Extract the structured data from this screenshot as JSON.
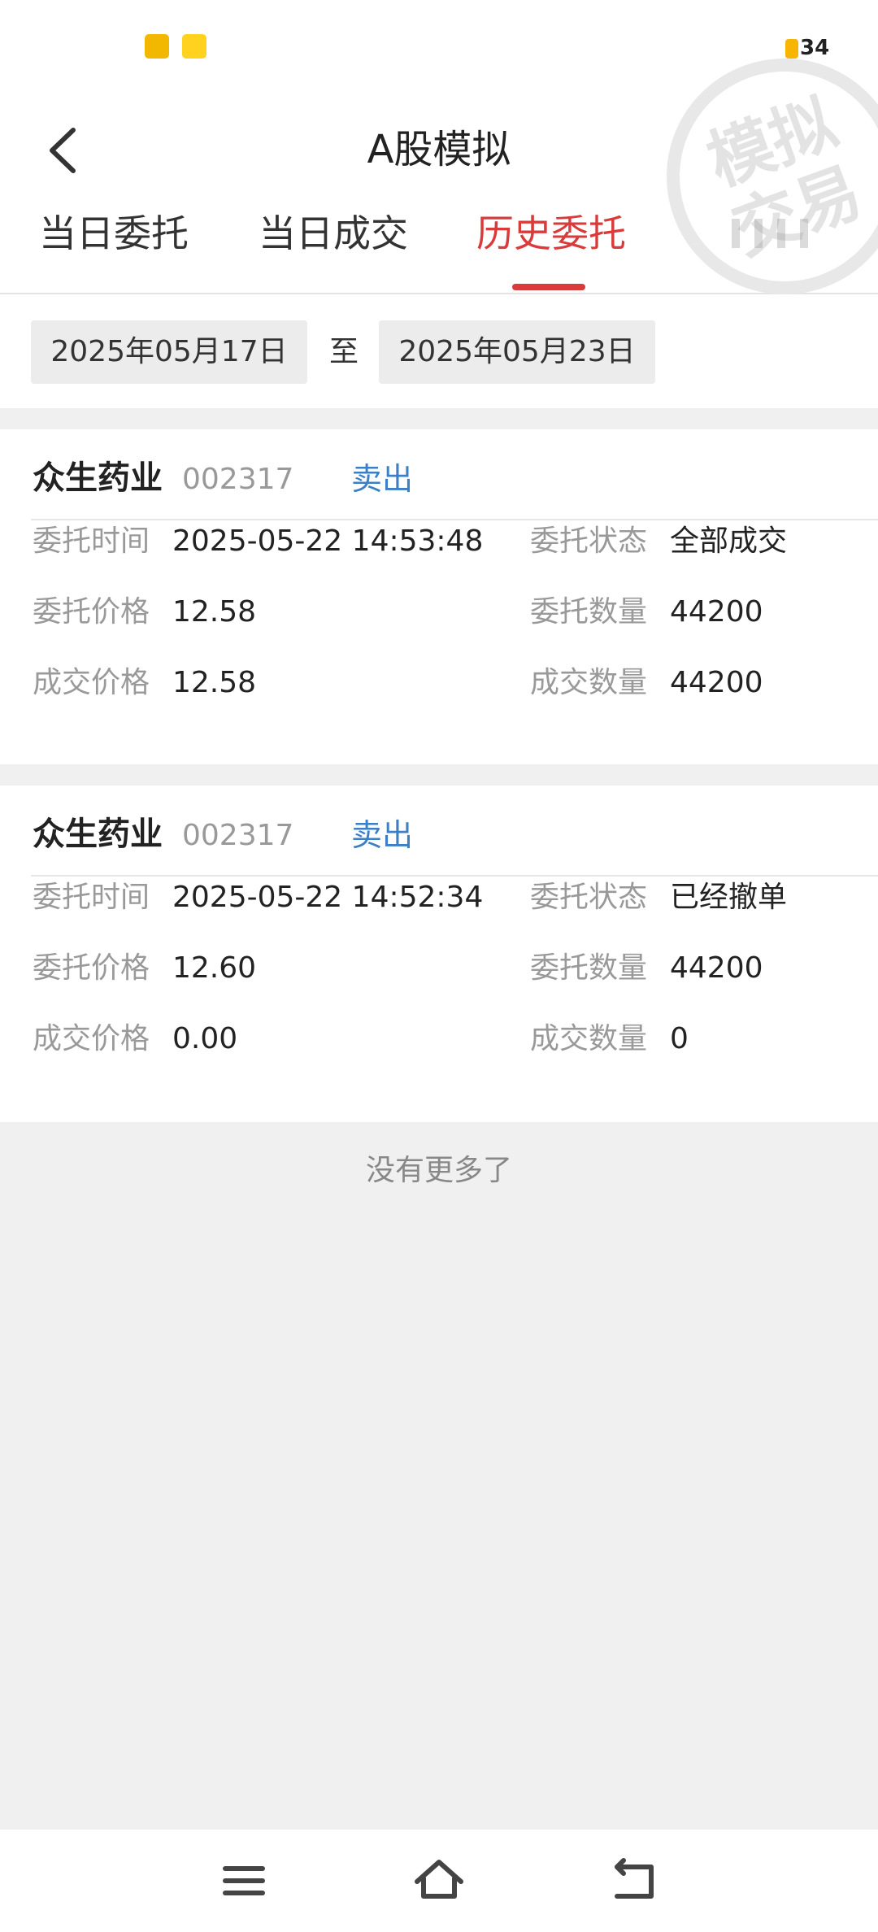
{
  "status_bar": {
    "battery": "34"
  },
  "header": {
    "title": "A股模拟"
  },
  "tabs": [
    {
      "label": "当日委托",
      "active": false
    },
    {
      "label": "当日成交",
      "active": false
    },
    {
      "label": "历史委托",
      "active": true
    }
  ],
  "watermark": {
    "line1": "模拟",
    "line2": "交易"
  },
  "date_range": {
    "start": "2025年05月17日",
    "separator": "至",
    "end": "2025年05月23日"
  },
  "labels": {
    "order_time": "委托时间",
    "order_status": "委托状态",
    "order_price": "委托价格",
    "order_qty": "委托数量",
    "deal_price": "成交价格",
    "deal_qty": "成交数量"
  },
  "orders": [
    {
      "name": "众生药业",
      "code": "002317",
      "side": "卖出",
      "order_time": "2025-05-22 14:53:48",
      "status": "全部成交",
      "order_price": "12.58",
      "order_qty": "44200",
      "deal_price": "12.58",
      "deal_qty": "44200"
    },
    {
      "name": "众生药业",
      "code": "002317",
      "side": "卖出",
      "order_time": "2025-05-22 14:52:34",
      "status": "已经撤单",
      "order_price": "12.60",
      "order_qty": "44200",
      "deal_price": "0.00",
      "deal_qty": "0"
    }
  ],
  "footer": {
    "no_more": "没有更多了"
  },
  "colors": {
    "accent": "#d93a3a",
    "link_blue": "#3c7fc5",
    "bg": "#f0f0f0"
  }
}
